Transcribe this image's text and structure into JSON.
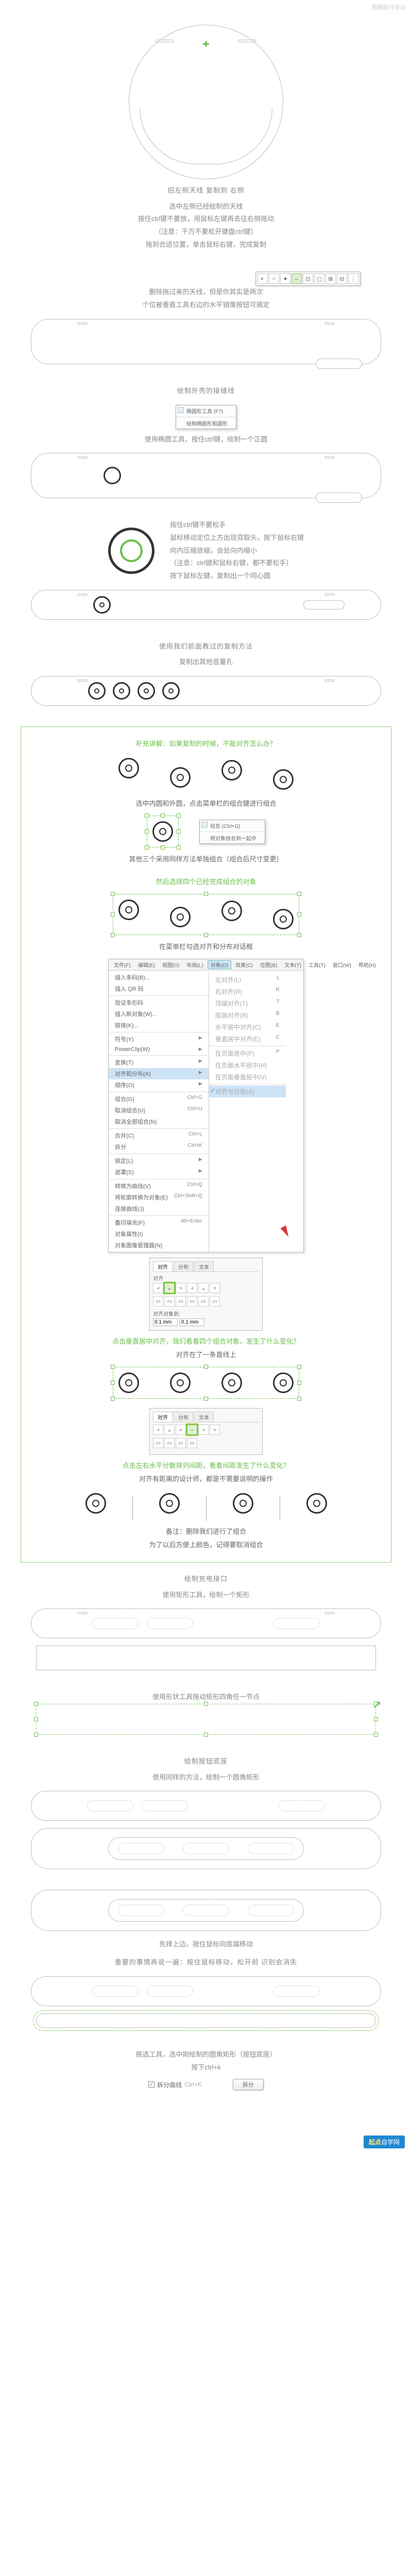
{
  "watermark": "图解绘开论坛",
  "sec1": {
    "title": "招左侧天线 复制到 右侧",
    "l1": "选中左侧已经绘制的天线",
    "l2": "按住ctrl键不要放，用鼠标左键再去往右侧拖动",
    "l3": "（注意：千万不要松开键盘ctrl键）",
    "l4": "拖到合适位置，单击鼠标右键，完成复制"
  },
  "sec2": {
    "p1": "删除拖过来的天线，但是你其实是两次",
    "p2": "个位被垂直工具右边的水平镜像按钮可搞定"
  },
  "toolbar_icons": [
    "◐",
    "○",
    "●",
    "↔",
    "⊡",
    "▢",
    "⊞",
    "⊟",
    "⋮"
  ],
  "sec3": {
    "title": "绘制外壳的接缝线",
    "ctx": {
      "name": "椭圆形工具 (F7)",
      "sc": "F7",
      "hint": "绘制椭圆形和圆形"
    },
    "p": "使用椭圆工具，按住ctrl键，绘制一个正圆"
  },
  "sec4": {
    "l1": "按住ctrl键不要松手",
    "l2": "鼠标移动定位上方出现双取头，按下鼠标右键",
    "l3": "向内压缩放缩，会处向内缩小",
    "l4": "（注意：ctrl键和鼠标右键，都不要松手）",
    "l5": "按下鼠标左键，复制出一个同心圆"
  },
  "sec5": {
    "title": "使用我们前面教过的复制方法",
    "sub": "复制出其他音量孔"
  },
  "info": {
    "q": "补充讲解：如果复制的时候，不能对齐怎么办？",
    "a1": "选中内圆和外圆，点击菜单栏的组合键进行组合",
    "ctx_group": {
      "name": "组合 (Ctrl+G)",
      "sc": "Ctrl+G",
      "hint": "将对象组合到一起中"
    },
    "a2": "其他三个采用同样方法单独组合（组合后尺寸变更）",
    "a3": "然后选择四个已经完成组合的对象",
    "a4": "在菜单栏勾选对齐和分布对话框",
    "menubar": [
      "文件(F)",
      "编辑(E)",
      "视图(V)",
      "布局(L)",
      "对象(O)",
      "效果(C)",
      "位图(B)",
      "文本(T)",
      "工具(T)",
      "窗口(W)",
      "帮助(H)"
    ],
    "menu_left": [
      {
        "t": "插入条码(B)..."
      },
      {
        "t": "插入 QR 码",
        "sep_after": true
      },
      {
        "t": "验证条形码"
      },
      {
        "t": "插入新对象(W)..."
      },
      {
        "t": "链接(K)...",
        "sep_after": true
      },
      {
        "t": "符号(Y)",
        "arr": true
      },
      {
        "t": "PowerClip(W)",
        "arr": true,
        "sep_after": true
      },
      {
        "t": "变换(T)",
        "arr": true
      },
      {
        "t": "对齐和分布(A)",
        "arr": true,
        "hi": true
      },
      {
        "t": "顺序(O)",
        "arr": true,
        "sep_after": true
      },
      {
        "t": "组合(G)",
        "sc": "Ctrl+G"
      },
      {
        "t": "取消组合(U)",
        "sc": "Ctrl+U"
      },
      {
        "t": "取消全部组合(N)",
        "sep_after": true
      },
      {
        "t": "合并(C)",
        "sc": "Ctrl+L"
      },
      {
        "t": "拆分",
        "sc": "Ctrl+K",
        "sep_after": true
      },
      {
        "t": "锁定(L)",
        "arr": true
      },
      {
        "t": "遮罩(S)",
        "arr": true,
        "sep_after": true
      },
      {
        "t": "转换为曲线(V)",
        "sc": "Ctrl+Q"
      },
      {
        "t": "将轮廓转换为对象(E)",
        "sc": "Ctrl+Shift+Q"
      },
      {
        "t": "连接曲线(J)",
        "sep_after": true
      },
      {
        "t": "叠印填充(F)",
        "sc": "Alt+Enter"
      },
      {
        "t": "对象属性(I)"
      },
      {
        "t": "对象图像管理器(N)"
      }
    ],
    "menu_right": [
      {
        "t": "左对齐(L)",
        "sc": "L"
      },
      {
        "t": "右对齐(R)",
        "sc": "R"
      },
      {
        "t": "顶端对齐(T)",
        "sc": "T"
      },
      {
        "t": "底端对齐(B)",
        "sc": "B"
      },
      {
        "t": "水平居中对齐(C)",
        "sc": "E"
      },
      {
        "t": "垂直居中对齐(E)",
        "sc": "C",
        "sep_after": true
      },
      {
        "t": "在页面居中(P)",
        "sc": "P"
      },
      {
        "t": "在页面水平居中(H)"
      },
      {
        "t": "在页面垂直居中(V)",
        "sep_after": true
      },
      {
        "t": "对齐与分布(A)",
        "hi": true,
        "chk": true
      }
    ],
    "palette_tabs": [
      "对齐",
      "分布",
      "文本"
    ],
    "palette_align": "对齐",
    "palette_field_label": "0.1 mm",
    "palette_note": "对齐对象到:",
    "a5": "点击垂直居中对齐，我们看着四个组合对象，发生了什么变化？",
    "a5b": "对齐在了一条直线上",
    "a6": "点击左右水平分散排列间距，看着间距发生了什么变化？",
    "a6b": "对齐有距离的设计师，都是不需要说明的操作",
    "a7": "备注：删除我们进行了组合",
    "a7b": "为了以后方便上颜色，记得要取消组合"
  },
  "sec6": {
    "title": "绘制充电接口",
    "p": "使用矩形工具，绘制一个矩形"
  },
  "sec7": {
    "p": "使用形状工具拖动矩形四角任一节点"
  },
  "sec8": {
    "title": "绘制按钮底座",
    "p": "使用同样的方法，绘制一个圆角矩形"
  },
  "sec9": {
    "p": "先择上边，按住鼠标向底端移动",
    "title": "重要的事情再说一遍：按住鼠标移动，松开前 识别会消失"
  },
  "sec10": {
    "p": "挑选工具，选中刚绘制的圆角矩形（按钮底座）",
    "p2": "按下ctrl+k"
  },
  "ctrl": {
    "chk_label": "拆分曲线",
    "sc": "Ctrl+K",
    "btn": "拆分"
  },
  "footer": {
    "brand": "起点",
    "text": "自学网"
  }
}
